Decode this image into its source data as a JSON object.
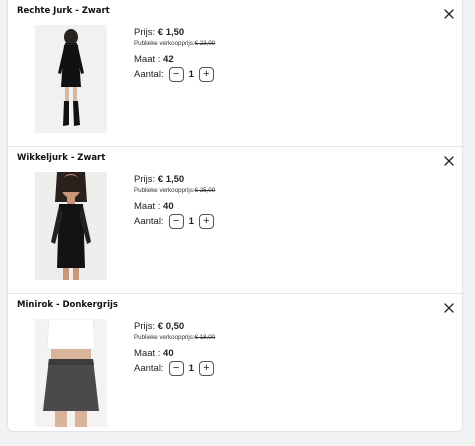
{
  "labels": {
    "price": "Prijs:",
    "rrp": "Publieke verkoopprijs:",
    "size": "Maat :",
    "quantity": "Aantal:",
    "minus": "−",
    "plus": "+"
  },
  "icons": {
    "remove": "close-icon"
  },
  "items": [
    {
      "name": "Rechte Jurk - Zwart",
      "price": "€ 1,50",
      "rrp": "€ 23,00",
      "size": "42",
      "qty": "1"
    },
    {
      "name": "Wikkeljurk - Zwart",
      "price": "€ 1,50",
      "rrp": "€ 25,00",
      "size": "40",
      "qty": "1"
    },
    {
      "name": "Minirok - Donkergrijs",
      "price": "€ 0,50",
      "rrp": "€ 18,00",
      "size": "40",
      "qty": "1"
    }
  ]
}
